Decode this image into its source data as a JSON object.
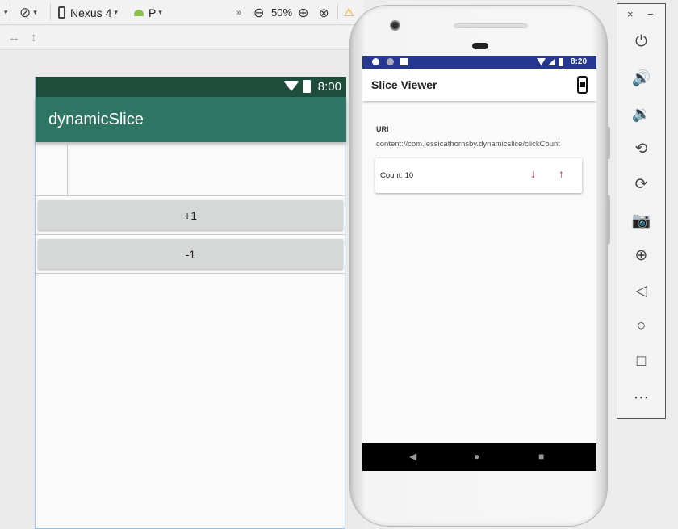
{
  "toolbar": {
    "device_name": "Nexus 4",
    "api_level": "P",
    "zoom": "50%",
    "overflow_icon": "double-chevron-icon",
    "warning_icon": "warning-icon"
  },
  "design_preview": {
    "status_time": "8:00",
    "app_title": "dynamicSlice",
    "buttons": [
      "+1",
      "-1"
    ]
  },
  "emulator": {
    "status_time": "8:20",
    "app_title": "Slice Viewer",
    "uri_label": "URI",
    "uri_value": "content://com.jessicathornsby.dynamicslice/clickCount",
    "count_text": "Count: 10",
    "down_glyph": "↓",
    "up_glyph": "↑",
    "nav": [
      "◀",
      "●",
      "■"
    ]
  },
  "side_panel": {
    "close_glyph": "×",
    "minimize_glyph": "−",
    "items": [
      "power-icon",
      "volume-up-icon",
      "volume-down-icon",
      "rotate-left-icon",
      "rotate-right-icon",
      "camera-icon",
      "zoom-icon",
      "back-icon",
      "home-icon",
      "overview-icon",
      "more-icon"
    ],
    "glyphs": [
      "⏻",
      "🔊",
      "🔉",
      "⟲",
      "⟳",
      "📷",
      "⊕",
      "◁",
      "○",
      "□",
      "⋯"
    ]
  },
  "colors": {
    "design_status": "#1f4d3c",
    "design_appbar": "#2e7563",
    "emulator_status": "#263790",
    "accent_arrow": "#e0245e"
  }
}
